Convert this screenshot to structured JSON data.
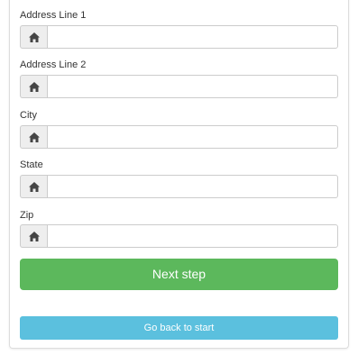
{
  "form": {
    "fields": [
      {
        "label": "Address Line 1",
        "value": "",
        "placeholder": "",
        "icon": "home-icon"
      },
      {
        "label": "Address Line 2",
        "value": "",
        "placeholder": "",
        "icon": "home-icon"
      },
      {
        "label": "City",
        "value": "",
        "placeholder": "",
        "icon": "home-icon"
      },
      {
        "label": "State",
        "value": "",
        "placeholder": "",
        "icon": "home-icon"
      },
      {
        "label": "Zip",
        "value": "",
        "placeholder": "",
        "icon": "home-icon"
      }
    ],
    "next_label": "Next step",
    "back_label": "Go back to start"
  },
  "colors": {
    "primary_success": "#5cb85c",
    "info": "#5bc0de",
    "addon_bg": "#eeeeee",
    "border": "#cccccc"
  }
}
